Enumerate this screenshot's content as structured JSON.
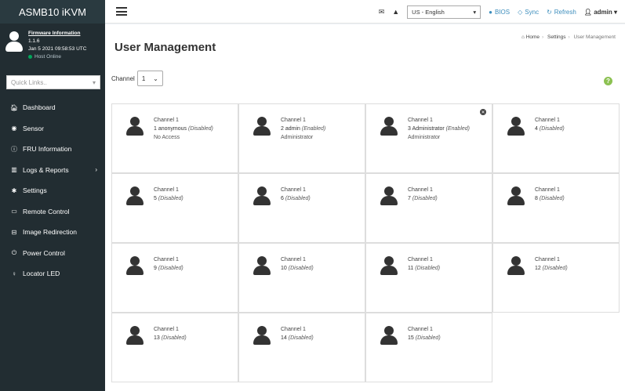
{
  "app": {
    "title": "ASMB10 iKVM",
    "firmware_label": "Firmware Information",
    "firmware_version": "1.1.6",
    "firmware_date": "Jan 5 2021 09:58:53 UTC",
    "host_status": "Host Online"
  },
  "sidebar": {
    "quick_links_placeholder": "Quick Links..",
    "items": [
      {
        "label": "Dashboard",
        "icon": "dashboard-icon"
      },
      {
        "label": "Sensor",
        "icon": "sensor-icon"
      },
      {
        "label": "FRU Information",
        "icon": "info-icon"
      },
      {
        "label": "Logs & Reports",
        "icon": "chart-icon"
      },
      {
        "label": "Settings",
        "icon": "gear-icon"
      },
      {
        "label": "Remote Control",
        "icon": "monitor-icon"
      },
      {
        "label": "Image Redirection",
        "icon": "hdd-icon"
      },
      {
        "label": "Power Control",
        "icon": "power-icon"
      },
      {
        "label": "Locator LED",
        "icon": "lightbulb-icon"
      }
    ]
  },
  "topbar": {
    "language": "US - English",
    "bios_label": "BIOS",
    "sync_label": "Sync",
    "refresh_label": "Refresh",
    "user_label": "admin"
  },
  "page": {
    "title": "User Management",
    "breadcrumb": [
      "Home",
      "Settings",
      "User Management"
    ],
    "channel_label": "Channel",
    "channel_value": "1"
  },
  "users": [
    {
      "channel": "Channel 1",
      "name": "1 anonymous",
      "state": "(Disabled)",
      "role": "No Access"
    },
    {
      "channel": "Channel 1",
      "name": "2 admin",
      "state": "(Enabled)",
      "role": "Administrator"
    },
    {
      "channel": "Channel 1",
      "name": "3 Administrator",
      "state": "(Enabled)",
      "role": "Administrator"
    },
    {
      "channel": "Channel 1",
      "name": "4",
      "state": "(Disabled)",
      "role": ""
    },
    {
      "channel": "Channel 1",
      "name": "5",
      "state": "(Disabled)",
      "role": ""
    },
    {
      "channel": "Channel 1",
      "name": "6",
      "state": "(Disabled)",
      "role": ""
    },
    {
      "channel": "Channel 1",
      "name": "7",
      "state": "(Disabled)",
      "role": ""
    },
    {
      "channel": "Channel 1",
      "name": "8",
      "state": "(Disabled)",
      "role": ""
    },
    {
      "channel": "Channel 1",
      "name": "9",
      "state": "(Disabled)",
      "role": ""
    },
    {
      "channel": "Channel 1",
      "name": "10",
      "state": "(Disabled)",
      "role": ""
    },
    {
      "channel": "Channel 1",
      "name": "11",
      "state": "(Disabled)",
      "role": ""
    },
    {
      "channel": "Channel 1",
      "name": "12",
      "state": "(Disabled)",
      "role": ""
    },
    {
      "channel": "Channel 1",
      "name": "13",
      "state": "(Disabled)",
      "role": ""
    },
    {
      "channel": "Channel 1",
      "name": "14",
      "state": "(Disabled)",
      "role": ""
    },
    {
      "channel": "Channel 1",
      "name": "15",
      "state": "(Disabled)",
      "role": ""
    }
  ]
}
